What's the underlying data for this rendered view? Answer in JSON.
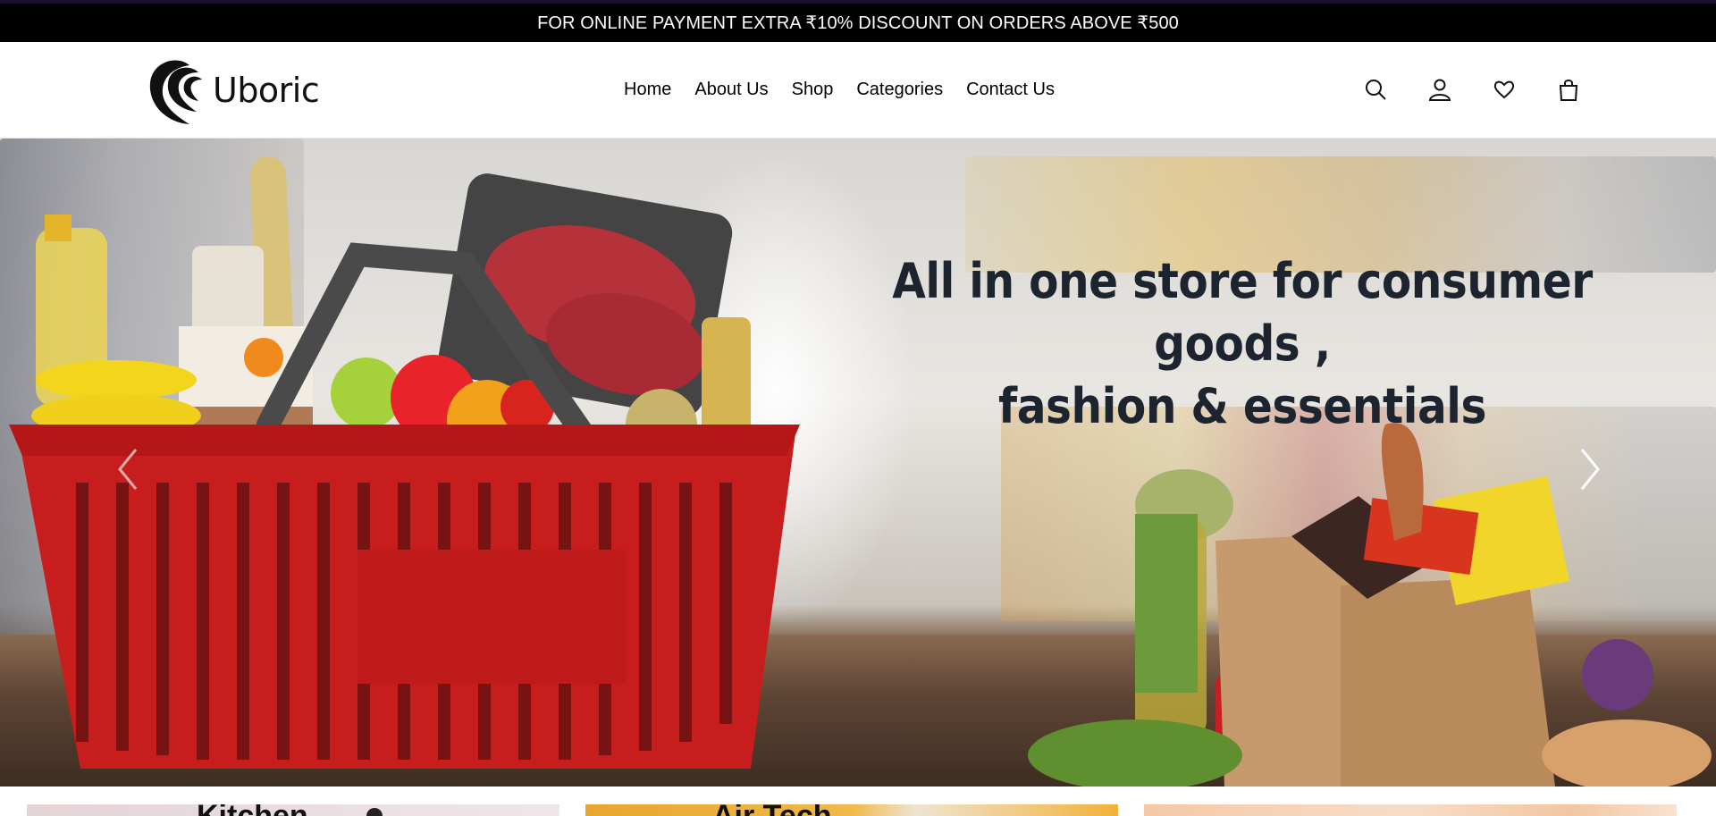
{
  "announcement": {
    "text": "FOR ONLINE PAYMENT EXTRA ₹10% DISCOUNT ON ORDERS ABOVE ₹500"
  },
  "brand": {
    "name": "Uboric"
  },
  "nav": {
    "items": [
      "Home",
      "About Us",
      "Shop",
      "Categories",
      "Contact Us"
    ]
  },
  "header_icons": [
    "search-icon",
    "user-icon",
    "heart-icon",
    "shopping-bag-icon"
  ],
  "hero": {
    "title_line1": "All in one store for consumer goods ,",
    "title_line2": "fashion & essentials",
    "prev_icon": "chevron-left-icon",
    "next_icon": "chevron-right-icon"
  },
  "category_cards": [
    {
      "title": "Kitchen"
    },
    {
      "title": "Air Tech"
    },
    {
      "title": ""
    }
  ],
  "colors": {
    "announcement_bg": "#000000",
    "text": "#111111",
    "basket_red": "#c81d1d"
  }
}
